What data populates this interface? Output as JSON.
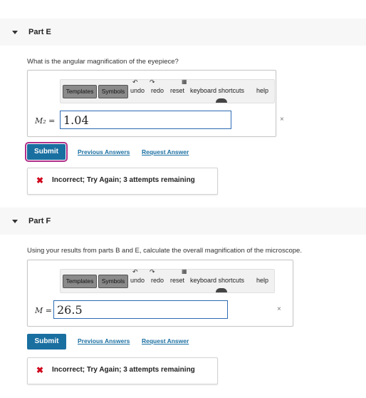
{
  "parts": [
    {
      "title": "Part E",
      "question": "What is the angular magnification of the eyepiece?",
      "toolbar": {
        "templates": "Templates",
        "symbols": "Symbols",
        "undo": "undo",
        "redo": "redo",
        "reset": "reset",
        "shortcuts": "keyboard shortcuts",
        "help": "help"
      },
      "variable": "M₂ =",
      "input_value": "1.04",
      "clear": "×",
      "submit": "Submit",
      "previous_answers": "Previous Answers",
      "request_answer": "Request Answer",
      "feedback": "Incorrect; Try Again; 3 attempts remaining"
    },
    {
      "title": "Part F",
      "question": "Using your results from parts B and E, calculate the overall magnification of the microscope.",
      "toolbar": {
        "templates": "Templates",
        "symbols": "Symbols",
        "undo": "undo",
        "redo": "redo",
        "reset": "reset",
        "shortcuts": "keyboard shortcuts",
        "help": "help"
      },
      "variable": "M =",
      "input_value": "26.5",
      "clear": "×",
      "submit": "Submit",
      "previous_answers": "Previous Answers",
      "request_answer": "Request Answer",
      "feedback": "Incorrect; Try Again; 3 attempts remaining"
    }
  ],
  "colors": {
    "accent": "#1a6fa1",
    "error": "#d0021b",
    "focus": "#b0308a",
    "input_border": "#2d6bb4"
  },
  "icons": {
    "collapse": "caret-down-icon",
    "undo": "undo-icon",
    "redo": "redo-icon",
    "reset": "reset-icon",
    "help": "help-icon",
    "incorrect": "x-mark-icon"
  }
}
